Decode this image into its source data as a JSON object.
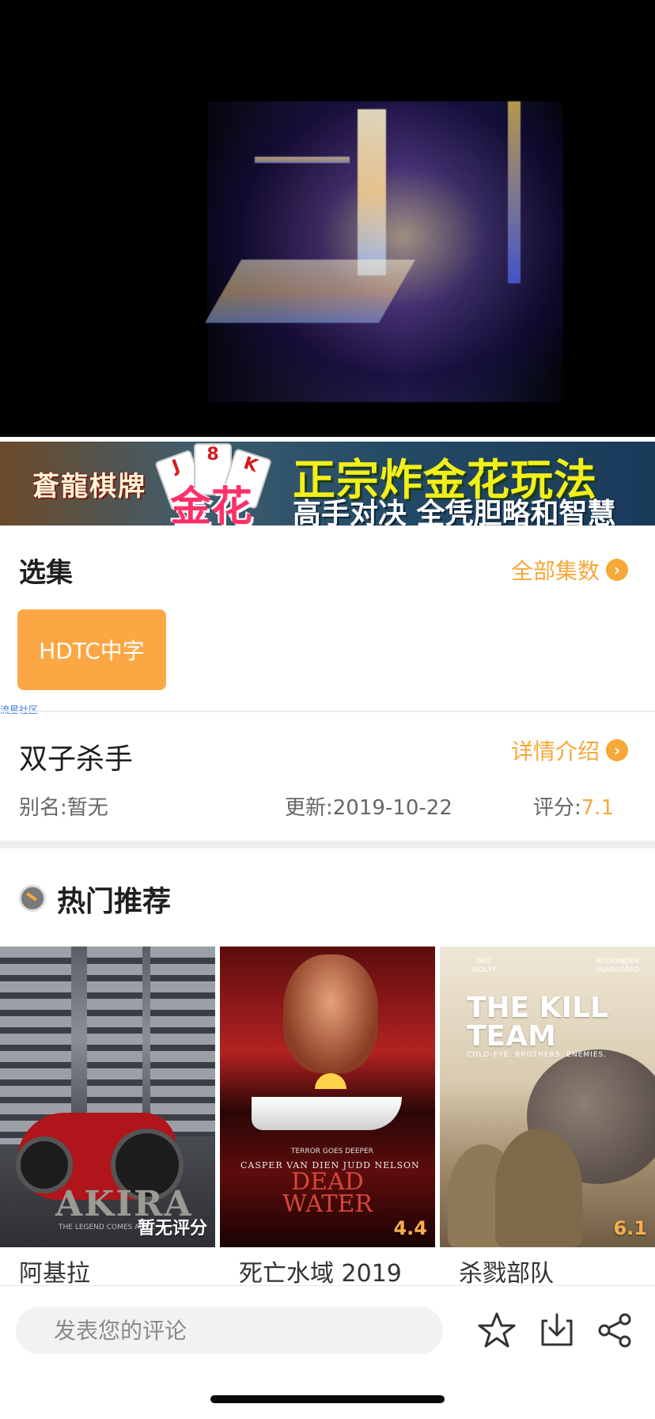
{
  "banner": {
    "logo": "蒼龍棋牌",
    "game": "金花",
    "cards": [
      "J",
      "8",
      "K"
    ],
    "headline": "正宗炸金花玩法",
    "subline": "高手对决 全凭胆略和智慧"
  },
  "episodes": {
    "title": "选集",
    "more_label": "全部集数",
    "items": [
      "HDTC中字"
    ]
  },
  "watermark": "流星社区",
  "detail": {
    "title": "双子杀手",
    "more_label": "详情介绍",
    "alias": "别名:暂无",
    "update": "更新:2019-10-22",
    "rating_label": "评分:",
    "rating_value": "7.1"
  },
  "recommend": {
    "title": "热门推荐",
    "items": [
      {
        "title": "阿基拉",
        "badge": "暂无评分",
        "poster_text": "AKIRA",
        "poster_tagline": "THE LEGEND COMES ALIVE"
      },
      {
        "title": "死亡水域 2019",
        "badge": "4.4",
        "poster_text": "DEAD WATER",
        "poster_cast": "CASPER VAN DIEN   JUDD NELSON",
        "poster_tagline": "TERROR GOES DEEPER"
      },
      {
        "title": "杀戮部队",
        "badge": "6.1",
        "poster_text": "THE KILL TEAM",
        "poster_cast_left": "NAT WOLFF",
        "poster_cast_right": "ALEXANDER SKARSGÅRD",
        "poster_tagline": "COLD-EYE. BROTHERS. ENEMIES."
      }
    ]
  },
  "comment": {
    "placeholder": "发表您的评论"
  },
  "icons": {
    "favorite": "star-icon",
    "download": "download-icon",
    "share": "share-icon"
  },
  "colors": {
    "accent": "#f6a839",
    "episode_button": "#fca744"
  }
}
